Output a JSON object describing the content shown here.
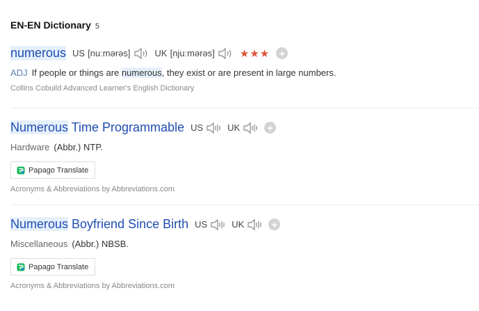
{
  "header": {
    "title": "EN-EN Dictionary",
    "count": "5"
  },
  "entries": [
    {
      "word": "numerous",
      "us_label": "US",
      "us_pron": "[nuːmərəs]",
      "uk_label": "UK",
      "uk_pron": "[njuːmərəs]",
      "stars": "★★★",
      "pos": "ADJ",
      "def_before": "If people or things are ",
      "def_highlight": "numerous",
      "def_after": ", they exist or are present in large numbers.",
      "source": "Collins Cobuild Advanced Learner's English Dictionary"
    },
    {
      "word_highlight": "Numerous",
      "word_rest": " Time Programmable",
      "us_label": "US",
      "uk_label": "UK",
      "category": "Hardware",
      "def": "(Abbr.) NTP.",
      "translate_label": "Papago Translate",
      "source": "Acronyms & Abbreviations by Abbreviations.com"
    },
    {
      "word_highlight": "Numerous",
      "word_rest": " Boyfriend Since Birth",
      "us_label": "US",
      "uk_label": "UK",
      "category": "Miscellaneous",
      "def": "(Abbr.) NBSB.",
      "translate_label": "Papago Translate",
      "source": "Acronyms & Abbreviations by Abbreviations.com"
    }
  ],
  "add_symbol": "+",
  "colors": {
    "headword": "#1f4db3",
    "star": "#e0523c",
    "highlight": "#e6f0fb"
  },
  "icons": [
    "speaker-icon",
    "add-icon",
    "papago-icon"
  ]
}
